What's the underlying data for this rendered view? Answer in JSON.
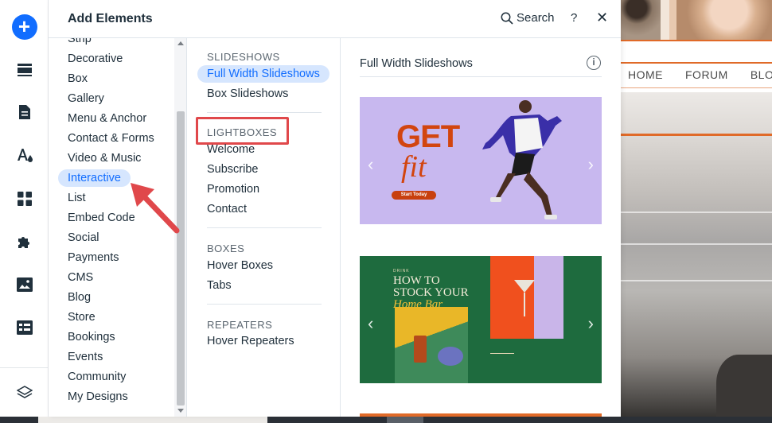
{
  "panel": {
    "title": "Add Elements",
    "search_label": "Search",
    "help_label": "?",
    "close_label": "✕"
  },
  "categories": [
    {
      "label": "Strip"
    },
    {
      "label": "Decorative"
    },
    {
      "label": "Box"
    },
    {
      "label": "Gallery"
    },
    {
      "label": "Menu & Anchor"
    },
    {
      "label": "Contact & Forms"
    },
    {
      "label": "Video & Music"
    },
    {
      "label": "Interactive",
      "selected": true
    },
    {
      "label": "List"
    },
    {
      "label": "Embed Code"
    },
    {
      "label": "Social"
    },
    {
      "label": "Payments"
    },
    {
      "label": "CMS"
    },
    {
      "label": "Blog"
    },
    {
      "label": "Store"
    },
    {
      "label": "Bookings"
    },
    {
      "label": "Events"
    },
    {
      "label": "Community"
    },
    {
      "label": "My Designs"
    }
  ],
  "sections": {
    "slideshows": {
      "heading": "SLIDESHOWS",
      "items": [
        "Full Width Slideshows",
        "Box Slideshows"
      ]
    },
    "lightboxes": {
      "heading": "LIGHTBOXES",
      "items": [
        "Welcome",
        "Subscribe",
        "Promotion",
        "Contact"
      ]
    },
    "boxes": {
      "heading": "BOXES",
      "items": [
        "Hover Boxes",
        "Tabs"
      ]
    },
    "repeaters": {
      "heading": "REPEATERS",
      "items": [
        "Hover Repeaters"
      ]
    }
  },
  "preview": {
    "title": "Full Width Slideshows",
    "info_label": "i",
    "slide1": {
      "headline_1": "GET",
      "headline_2": "fit",
      "cta": "Start Today",
      "prev": "‹",
      "next": "›"
    },
    "slide2": {
      "kicker": "DRINK",
      "headline": "HOW TO STOCK YOUR",
      "headline_italic": "Home Bar",
      "prev": "‹",
      "next": "›"
    }
  },
  "site": {
    "nav": [
      "HOME",
      "FORUM",
      "BLOG"
    ]
  },
  "colors": {
    "accent": "#116dff",
    "selected_bg": "#d6e6fe",
    "annotation": "#e0484b",
    "site_orange": "#e06a28"
  }
}
